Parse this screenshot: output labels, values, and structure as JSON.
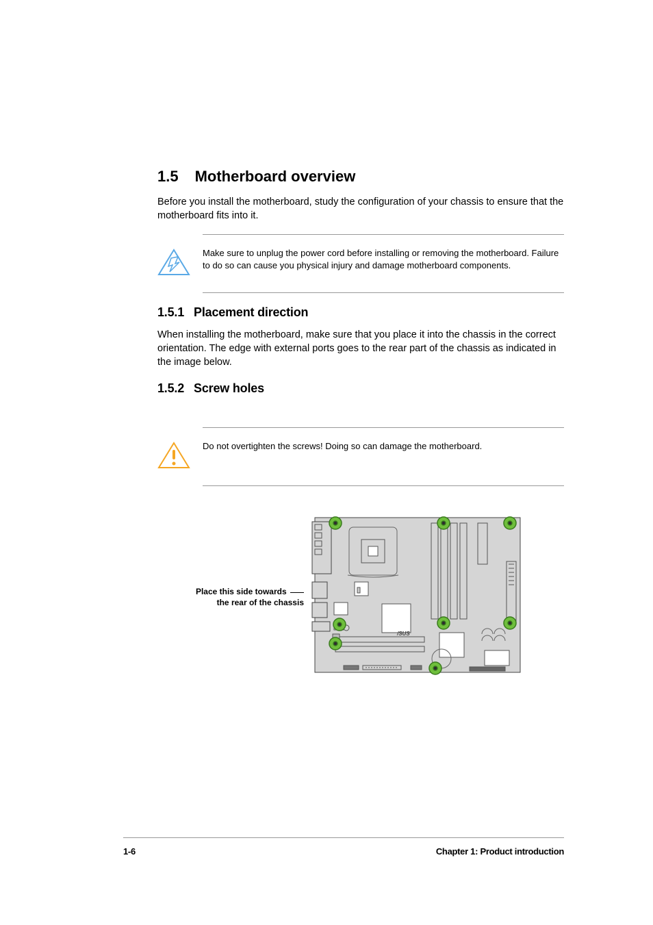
{
  "section": {
    "number": "1.5",
    "title": "Motherboard overview",
    "intro": "Before you install the motherboard, study the configuration of your chassis to ensure that the motherboard fits into it."
  },
  "warning1": {
    "text": "Make sure to unplug the power cord before installing or removing the motherboard. Failure to do so can cause you physical injury and damage motherboard components."
  },
  "sub1": {
    "number": "1.5.1",
    "title": "Placement direction",
    "text": "When installing the motherboard, make sure that you place it into the chassis in the correct orientation. The edge with external ports goes to the rear part of the chassis as indicated in the image below."
  },
  "sub2": {
    "number": "1.5.2",
    "title": "Screw holes"
  },
  "warning2": {
    "text": "Do not overtighten the screws! Doing so can damage the motherboard."
  },
  "mobo": {
    "label_line1": "Place this side towards",
    "label_line2": "the rear of the chassis",
    "brand": "/SUS"
  },
  "footer": {
    "page": "1-6",
    "chapter": "Chapter 1: Product introduction"
  }
}
